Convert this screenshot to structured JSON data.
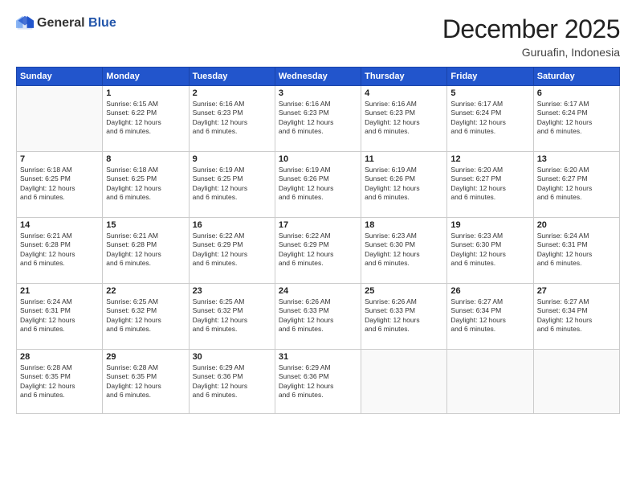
{
  "logo": {
    "general": "General",
    "blue": "Blue"
  },
  "header": {
    "month": "December 2025",
    "location": "Guruafin, Indonesia"
  },
  "weekdays": [
    "Sunday",
    "Monday",
    "Tuesday",
    "Wednesday",
    "Thursday",
    "Friday",
    "Saturday"
  ],
  "weeks": [
    [
      {
        "day": "",
        "info": ""
      },
      {
        "day": "1",
        "info": "Sunrise: 6:15 AM\nSunset: 6:22 PM\nDaylight: 12 hours\nand 6 minutes."
      },
      {
        "day": "2",
        "info": "Sunrise: 6:16 AM\nSunset: 6:23 PM\nDaylight: 12 hours\nand 6 minutes."
      },
      {
        "day": "3",
        "info": "Sunrise: 6:16 AM\nSunset: 6:23 PM\nDaylight: 12 hours\nand 6 minutes."
      },
      {
        "day": "4",
        "info": "Sunrise: 6:16 AM\nSunset: 6:23 PM\nDaylight: 12 hours\nand 6 minutes."
      },
      {
        "day": "5",
        "info": "Sunrise: 6:17 AM\nSunset: 6:24 PM\nDaylight: 12 hours\nand 6 minutes."
      },
      {
        "day": "6",
        "info": "Sunrise: 6:17 AM\nSunset: 6:24 PM\nDaylight: 12 hours\nand 6 minutes."
      }
    ],
    [
      {
        "day": "7",
        "info": "Sunrise: 6:18 AM\nSunset: 6:25 PM\nDaylight: 12 hours\nand 6 minutes."
      },
      {
        "day": "8",
        "info": "Sunrise: 6:18 AM\nSunset: 6:25 PM\nDaylight: 12 hours\nand 6 minutes."
      },
      {
        "day": "9",
        "info": "Sunrise: 6:19 AM\nSunset: 6:25 PM\nDaylight: 12 hours\nand 6 minutes."
      },
      {
        "day": "10",
        "info": "Sunrise: 6:19 AM\nSunset: 6:26 PM\nDaylight: 12 hours\nand 6 minutes."
      },
      {
        "day": "11",
        "info": "Sunrise: 6:19 AM\nSunset: 6:26 PM\nDaylight: 12 hours\nand 6 minutes."
      },
      {
        "day": "12",
        "info": "Sunrise: 6:20 AM\nSunset: 6:27 PM\nDaylight: 12 hours\nand 6 minutes."
      },
      {
        "day": "13",
        "info": "Sunrise: 6:20 AM\nSunset: 6:27 PM\nDaylight: 12 hours\nand 6 minutes."
      }
    ],
    [
      {
        "day": "14",
        "info": "Sunrise: 6:21 AM\nSunset: 6:28 PM\nDaylight: 12 hours\nand 6 minutes."
      },
      {
        "day": "15",
        "info": "Sunrise: 6:21 AM\nSunset: 6:28 PM\nDaylight: 12 hours\nand 6 minutes."
      },
      {
        "day": "16",
        "info": "Sunrise: 6:22 AM\nSunset: 6:29 PM\nDaylight: 12 hours\nand 6 minutes."
      },
      {
        "day": "17",
        "info": "Sunrise: 6:22 AM\nSunset: 6:29 PM\nDaylight: 12 hours\nand 6 minutes."
      },
      {
        "day": "18",
        "info": "Sunrise: 6:23 AM\nSunset: 6:30 PM\nDaylight: 12 hours\nand 6 minutes."
      },
      {
        "day": "19",
        "info": "Sunrise: 6:23 AM\nSunset: 6:30 PM\nDaylight: 12 hours\nand 6 minutes."
      },
      {
        "day": "20",
        "info": "Sunrise: 6:24 AM\nSunset: 6:31 PM\nDaylight: 12 hours\nand 6 minutes."
      }
    ],
    [
      {
        "day": "21",
        "info": "Sunrise: 6:24 AM\nSunset: 6:31 PM\nDaylight: 12 hours\nand 6 minutes."
      },
      {
        "day": "22",
        "info": "Sunrise: 6:25 AM\nSunset: 6:32 PM\nDaylight: 12 hours\nand 6 minutes."
      },
      {
        "day": "23",
        "info": "Sunrise: 6:25 AM\nSunset: 6:32 PM\nDaylight: 12 hours\nand 6 minutes."
      },
      {
        "day": "24",
        "info": "Sunrise: 6:26 AM\nSunset: 6:33 PM\nDaylight: 12 hours\nand 6 minutes."
      },
      {
        "day": "25",
        "info": "Sunrise: 6:26 AM\nSunset: 6:33 PM\nDaylight: 12 hours\nand 6 minutes."
      },
      {
        "day": "26",
        "info": "Sunrise: 6:27 AM\nSunset: 6:34 PM\nDaylight: 12 hours\nand 6 minutes."
      },
      {
        "day": "27",
        "info": "Sunrise: 6:27 AM\nSunset: 6:34 PM\nDaylight: 12 hours\nand 6 minutes."
      }
    ],
    [
      {
        "day": "28",
        "info": "Sunrise: 6:28 AM\nSunset: 6:35 PM\nDaylight: 12 hours\nand 6 minutes."
      },
      {
        "day": "29",
        "info": "Sunrise: 6:28 AM\nSunset: 6:35 PM\nDaylight: 12 hours\nand 6 minutes."
      },
      {
        "day": "30",
        "info": "Sunrise: 6:29 AM\nSunset: 6:36 PM\nDaylight: 12 hours\nand 6 minutes."
      },
      {
        "day": "31",
        "info": "Sunrise: 6:29 AM\nSunset: 6:36 PM\nDaylight: 12 hours\nand 6 minutes."
      },
      {
        "day": "",
        "info": ""
      },
      {
        "day": "",
        "info": ""
      },
      {
        "day": "",
        "info": ""
      }
    ]
  ]
}
